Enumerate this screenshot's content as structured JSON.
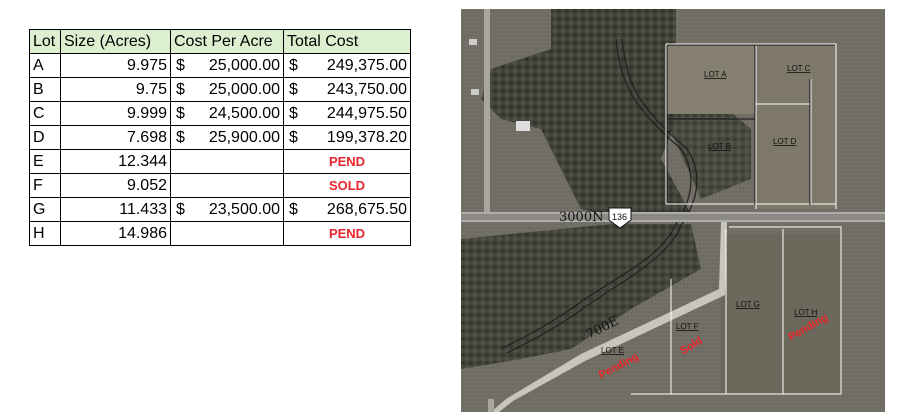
{
  "table": {
    "headers": {
      "lot": "Lot",
      "size": "Size (Acres)",
      "cost_per_acre": "Cost Per Acre",
      "total_cost": "Total Cost"
    },
    "rows": [
      {
        "lot": "A",
        "size": "9.975",
        "cpa_cur": "$",
        "cpa": "25,000.00",
        "tot_cur": "$",
        "tot": "249,375.00",
        "status": ""
      },
      {
        "lot": "B",
        "size": "9.75",
        "cpa_cur": "$",
        "cpa": "25,000.00",
        "tot_cur": "$",
        "tot": "243,750.00",
        "status": ""
      },
      {
        "lot": "C",
        "size": "9.999",
        "cpa_cur": "$",
        "cpa": "24,500.00",
        "tot_cur": "$",
        "tot": "244,975.50",
        "status": ""
      },
      {
        "lot": "D",
        "size": "7.698",
        "cpa_cur": "$",
        "cpa": "25,900.00",
        "tot_cur": "$",
        "tot": "199,378.20",
        "status": ""
      },
      {
        "lot": "E",
        "size": "12.344",
        "cpa_cur": "",
        "cpa": "",
        "tot_cur": "",
        "tot": "",
        "status": "PEND"
      },
      {
        "lot": "F",
        "size": "9.052",
        "cpa_cur": "",
        "cpa": "",
        "tot_cur": "",
        "tot": "",
        "status": "SOLD"
      },
      {
        "lot": "G",
        "size": "11.433",
        "cpa_cur": "$",
        "cpa": "23,500.00",
        "tot_cur": "$",
        "tot": "268,675.50",
        "status": ""
      },
      {
        "lot": "H",
        "size": "14.986",
        "cpa_cur": "",
        "cpa": "",
        "tot_cur": "",
        "tot": "",
        "status": "PEND"
      }
    ]
  },
  "map": {
    "road_north_label": "3000N",
    "route_shield": "136",
    "road_east_label": "700E",
    "lot_labels": {
      "a": "LOT A",
      "b": "LOT B",
      "c": "LOT C",
      "d": "LOT D",
      "e": "LOT E",
      "f": "LOT F",
      "g": "LOT G",
      "h": "LOT H"
    },
    "overlays": {
      "e": "Pending",
      "f": "Sold",
      "h": "Pending"
    },
    "colors": {
      "status_red": "#e8262a",
      "header_green": "#dcefcf",
      "boundary": "#ffffff"
    }
  }
}
